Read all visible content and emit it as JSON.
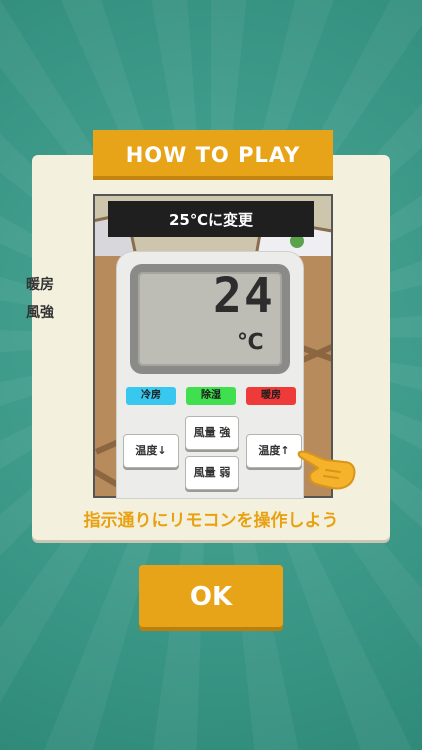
{
  "banner": {
    "title": "HOW TO PLAY"
  },
  "instruction": {
    "text": "25℃に変更"
  },
  "remote": {
    "mode_label": "暖房",
    "fan_label": "風強",
    "temperature": "24",
    "unit": "℃",
    "mode_buttons": [
      "冷房",
      "除湿",
      "暖房"
    ],
    "temp_down": "温度↓",
    "temp_up": "温度↑",
    "fan_strong": "風量 強",
    "fan_weak": "風量 弱"
  },
  "caption": "指示通りにリモコンを操作しよう",
  "ok_label": "OK",
  "colors": {
    "accent": "#e8a418",
    "background": "#3f9c8b",
    "cool": "#38c7ef",
    "dry": "#3fdf4f",
    "heat": "#ef3a3a"
  },
  "icons": {
    "pointer": "pointing-hand-icon"
  }
}
